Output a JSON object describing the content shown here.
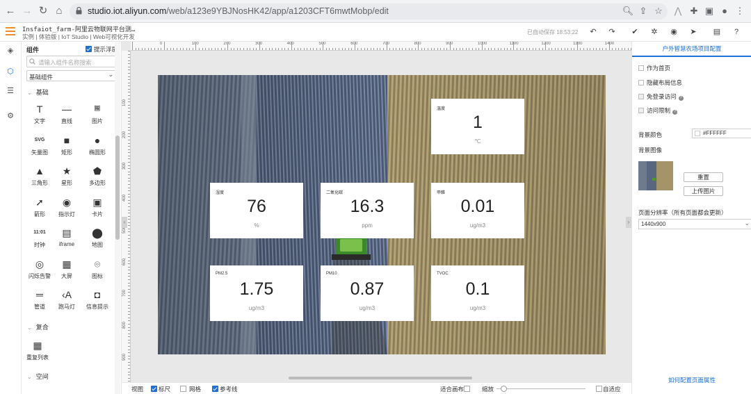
{
  "browser": {
    "url_host": "studio.iot.aliyun.com",
    "url_path": "/web/a123e9YBJNosHK42/app/a1203CFT6mwtMobp/edit"
  },
  "app": {
    "title": "Insfaiot_farm-阿里云物联网平台测…",
    "subtitle": "实例 | 体验版 | IoT Studio | Web可视化开发",
    "saved_status": "已自动保存 18:53:22"
  },
  "component_panel": {
    "title": "组件",
    "show_float_label": "提示浮层",
    "search_placeholder": "请输入组件名称搜索",
    "category": "基础组件",
    "group_basic": "基础",
    "group_composite": "复合",
    "group_space": "空间",
    "components": [
      {
        "label": "文字",
        "icon": "text-icon"
      },
      {
        "label": "直线",
        "icon": "line-icon"
      },
      {
        "label": "图片",
        "icon": "image-icon"
      },
      {
        "label": "矢量图",
        "icon": "svg-icon"
      },
      {
        "label": "矩形",
        "icon": "rectangle-icon"
      },
      {
        "label": "椭圆形",
        "icon": "ellipse-icon"
      },
      {
        "label": "三角形",
        "icon": "triangle-icon"
      },
      {
        "label": "星形",
        "icon": "star-icon"
      },
      {
        "label": "多边形",
        "icon": "polygon-icon"
      },
      {
        "label": "箭形",
        "icon": "arrow-icon"
      },
      {
        "label": "指示灯",
        "icon": "indicator-icon"
      },
      {
        "label": "卡片",
        "icon": "card-icon"
      },
      {
        "label": "时钟",
        "icon": "clock-icon"
      },
      {
        "label": "iframe",
        "icon": "iframe-icon"
      },
      {
        "label": "地图",
        "icon": "map-pin-icon"
      },
      {
        "label": "闪烁告警",
        "icon": "flash-alarm-icon"
      },
      {
        "label": "大屏",
        "icon": "big-screen-icon"
      },
      {
        "label": "图标",
        "icon": "icon-icon"
      },
      {
        "label": "管道",
        "icon": "pipe-icon"
      },
      {
        "label": "跑马灯",
        "icon": "marquee-icon"
      },
      {
        "label": "信息提示",
        "icon": "info-tip-icon"
      }
    ],
    "composite_components": [
      {
        "label": "重复列表",
        "icon": "repeat-list-icon"
      }
    ],
    "vsvg_label": "SVG",
    "clock_label": "11:01"
  },
  "ruler": {
    "h_ticks": [
      "0",
      "100",
      "200",
      "300",
      "400",
      "500",
      "600",
      "700",
      "800",
      "900",
      "1000",
      "1100",
      "1200",
      "1300",
      "1400",
      "150"
    ],
    "v_ticks": [
      "100",
      "200",
      "300",
      "400",
      "500",
      "600",
      "700",
      "800",
      "900"
    ]
  },
  "cards": [
    {
      "title": "温度",
      "value": "1",
      "unit": "℃"
    },
    {
      "title": "湿度",
      "value": "76",
      "unit": "%"
    },
    {
      "title": "二氧化碳",
      "value": "16.3",
      "unit": "ppm"
    },
    {
      "title": "甲醛",
      "value": "0.01",
      "unit": "ug/m3"
    },
    {
      "title": "PM2.5",
      "value": "1.75",
      "unit": "ug/m3"
    },
    {
      "title": "PM10",
      "value": "0.87",
      "unit": "ug/m3"
    },
    {
      "title": "TVOC",
      "value": "0.1",
      "unit": "ug/m3"
    }
  ],
  "status_bar": {
    "view": "视图",
    "ruler": "标尺",
    "grid": "网格",
    "guides": "参考线",
    "fit_canvas": "适合画布",
    "zoom": "缩放",
    "adaptive": "自适应"
  },
  "right_panel": {
    "title": "户外智慧农场项目配置",
    "as_home": "作为首页",
    "hide_layout": "隐藏布局信息",
    "no_login": "免登录访问",
    "access_limit": "访问限制",
    "bg_color_label": "背景颜色",
    "bg_color_value": "#FFFFFF",
    "bg_image_label": "背景图像",
    "reset_button": "重置",
    "upload_button": "上传图片",
    "resolution_label": "页面分辨率（所有页面都会更新）",
    "resolution_value": "1440x900",
    "config_link": "如何配置页面属性"
  },
  "colors": {
    "accent": "#1e6fd9",
    "menu": "#f08c2c",
    "card_bg": "#ffffff"
  }
}
